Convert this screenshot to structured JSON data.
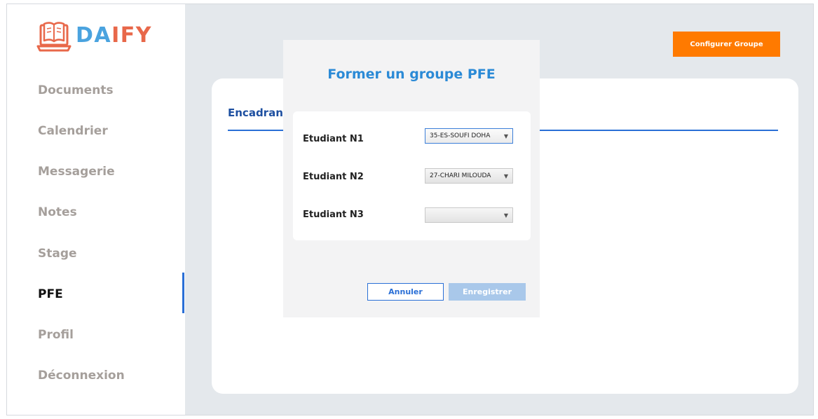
{
  "brand": {
    "part1": "DA",
    "part2": "IFY",
    "icon": "laptop-book-icon",
    "color_blue": "#4aa3df",
    "color_orange": "#e8684a"
  },
  "sidebar": {
    "items": [
      {
        "label": "Documents",
        "active": false
      },
      {
        "label": "Calendrier",
        "active": false
      },
      {
        "label": "Messagerie",
        "active": false
      },
      {
        "label": "Notes",
        "active": false
      },
      {
        "label": "Stage",
        "active": false
      },
      {
        "label": "PFE",
        "active": true
      },
      {
        "label": "Profil",
        "active": false
      },
      {
        "label": "Déconnexion",
        "active": false
      }
    ],
    "active_indicator_color": "#2a6fd6"
  },
  "header": {
    "configure_button": "Configurer Groupe",
    "configure_button_color": "#ff7a00"
  },
  "card": {
    "title": "Encadrant"
  },
  "dialog": {
    "title": "Former un groupe PFE",
    "rows": [
      {
        "label": "Etudiant N1",
        "value": "35-ES-SOUFI DOHA",
        "focused": true
      },
      {
        "label": "Etudiant N2",
        "value": "27-CHARI MILOUDA",
        "focused": false
      },
      {
        "label": "Etudiant N3",
        "value": "",
        "focused": false
      }
    ],
    "cancel_label": "Annuler",
    "save_label": "Enregistrer",
    "save_disabled": true
  }
}
